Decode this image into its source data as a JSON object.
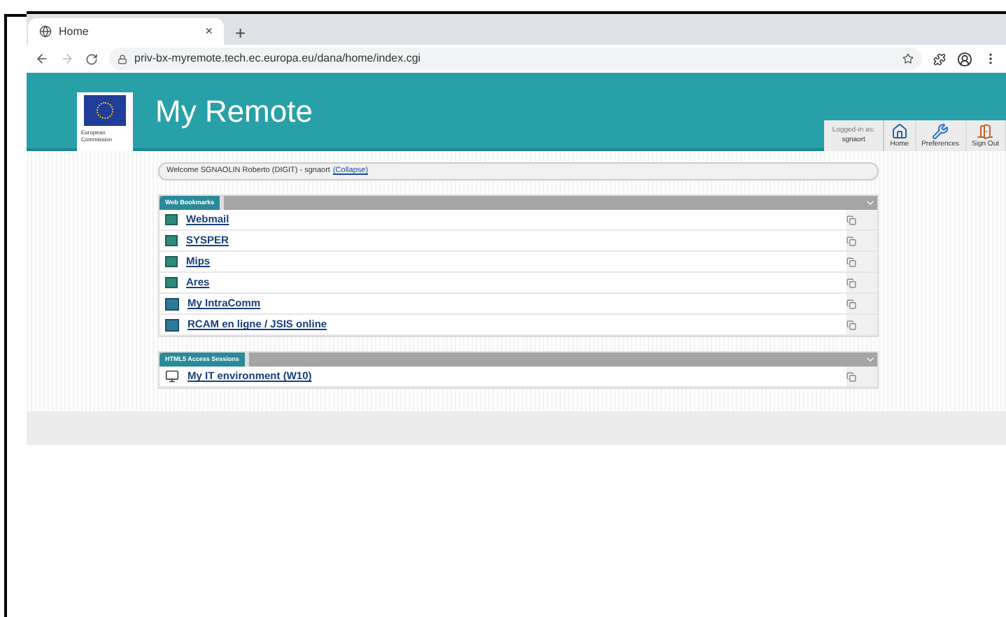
{
  "browser": {
    "tab_title": "Home",
    "new_tab": "+",
    "close_tab": "×",
    "url": "priv-bx-myremote.tech.ec.europa.eu/dana/home/index.cgi"
  },
  "header": {
    "logo_text": "European Commission",
    "title": "My Remote",
    "logged_in_label": "Logged-in as:",
    "username": "sgnaort",
    "nav": [
      {
        "kind": "home",
        "label": "Home"
      },
      {
        "kind": "preferences",
        "label": "Preferences"
      },
      {
        "kind": "signout",
        "label": "Sign Out"
      }
    ]
  },
  "welcome": {
    "text": "Welcome SGNAOLIN Roberto (DIGIT) - sgnaort",
    "link": "(Collapse)"
  },
  "panels": [
    {
      "title": "Web Bookmarks",
      "items": [
        {
          "kind": "web",
          "label": "Webmail"
        },
        {
          "kind": "web",
          "label": "SYSPER"
        },
        {
          "kind": "web",
          "label": "Mips"
        },
        {
          "kind": "web",
          "label": "Ares"
        },
        {
          "kind": "web2",
          "label": "My IntraComm"
        },
        {
          "kind": "web2",
          "label": "RCAM en ligne / JSIS online"
        }
      ]
    },
    {
      "title": "HTML5 Access Sessions",
      "items": [
        {
          "kind": "session",
          "label": "My IT environment (W10)"
        }
      ]
    }
  ]
}
